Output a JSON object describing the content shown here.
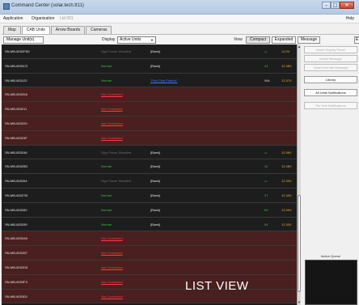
{
  "window": {
    "title": "Command Center (solar.tech.tt11)",
    "controls": {
      "minimize": "–",
      "maximize": "□",
      "close": "✕"
    }
  },
  "menubar": {
    "items": [
      "Application",
      "Organization",
      "Ltd 001"
    ],
    "help": "Help"
  },
  "tabs": [
    {
      "label": "Map",
      "active": false
    },
    {
      "label": "CAB Units",
      "active": true
    },
    {
      "label": "Arrow Boards",
      "active": false
    },
    {
      "label": "Cameras",
      "active": false
    }
  ],
  "toolbar": {
    "manage_label": "Manage Unit(s)",
    "display_label": "Display",
    "display_value": "Active Units",
    "view_label": "View",
    "view_options": [
      "Compact",
      "Expanded",
      "Message"
    ],
    "view_selected": "Compact",
    "edge_label": "E"
  },
  "units": [
    {
      "id": "SN-MB-8032F6D",
      "status": "Sign Power Disabled",
      "msg": "[Blank]",
      "v": "ٹ",
      "bat": "12.0V",
      "state": "ok"
    },
    {
      "id": "SN-MB-8030C2",
      "status": "Normal",
      "msg": "[Blank]",
      "v": "41",
      "bat": "12.38V",
      "state": "ok"
    },
    {
      "id": "SN-MB-803122",
      "status": "Normal",
      "msg": "\"Print Test Pattern\"",
      "v": "N/A",
      "bat": "12.57V",
      "state": "ok"
    },
    {
      "id": "SN-MB-80320A",
      "status": "Not Connected",
      "msg": "",
      "v": "",
      "bat": "",
      "state": "nc"
    },
    {
      "id": "SN-MB-803211",
      "status": "Not Connected",
      "msg": "",
      "v": "",
      "bat": "",
      "state": "nc"
    },
    {
      "id": "SN-MB-803229",
      "status": "Not Connected",
      "msg": "",
      "v": "",
      "bat": "",
      "state": "nc"
    },
    {
      "id": "SN-MB-80323F",
      "status": "Not Connected",
      "msg": "",
      "v": "",
      "bat": "",
      "state": "nc"
    },
    {
      "id": "SN-MB-803246",
      "status": "Sign Power Disabled",
      "msg": "[Blank]",
      "v": "ٹ",
      "bat": "12.58V",
      "state": "ok"
    },
    {
      "id": "SN-MB-80325D",
      "status": "Normal",
      "msg": "[Blank]",
      "v": "42",
      "bat": "12.48V",
      "state": "ok"
    },
    {
      "id": "SN-MB-803264",
      "status": "Sign Power Disabled",
      "msg": "[Blank]",
      "v": "ٹ",
      "bat": "12.39V",
      "state": "ok"
    },
    {
      "id": "SN-MB-80327B",
      "status": "Normal",
      "msg": "[Blank]",
      "v": "37",
      "bat": "12.49V",
      "state": "ok"
    },
    {
      "id": "SN-MB-803282",
      "status": "Normal",
      "msg": "[Blank]",
      "v": "69",
      "bat": "12.59V",
      "state": "ok"
    },
    {
      "id": "SN-MB-803299",
      "status": "Normal",
      "msg": "[Blank]",
      "v": "54",
      "bat": "12.53V",
      "state": "ok"
    },
    {
      "id": "SN-MB-8032A0",
      "status": "Not Connected",
      "msg": "",
      "v": "",
      "bat": "",
      "state": "nc"
    },
    {
      "id": "SN-MB-8032B7",
      "status": "Not Connected",
      "msg": "",
      "v": "",
      "bat": "",
      "state": "nc"
    },
    {
      "id": "SN-MB-8032D5",
      "status": "Not Connected",
      "msg": "",
      "v": "",
      "bat": "",
      "state": "nc"
    },
    {
      "id": "SN-MB-8033F3",
      "status": "Not Connected",
      "msg": "",
      "v": "",
      "bat": "",
      "state": "nc"
    },
    {
      "id": "SN-MB-803303",
      "status": "Not Connected",
      "msg": "",
      "v": "",
      "bat": "",
      "state": "nc"
    }
  ],
  "right_panel": {
    "buttons": [
      {
        "label": "Blank Display Panel",
        "enabled": false
      },
      {
        "label": "Install Message",
        "enabled": false
      },
      {
        "label": "Clear/Override Message",
        "enabled": false
      },
      {
        "label": "Library",
        "enabled": true
      },
      {
        "label": "All Units Notifications",
        "enabled": true
      },
      {
        "label": "Per Unit Notifications",
        "enabled": false
      }
    ],
    "action_queue_label": "Action Queue"
  },
  "scroll": {
    "up": "▲",
    "down": "▼"
  },
  "overlay_text": "LIST VIEW",
  "colors": {
    "row_ok_bg": "#1d1d1d",
    "row_nc_bg": "#4a1f1f",
    "status_normal": "#36c236",
    "status_disabled": "#6f6f6f",
    "status_not_connected": "#ff3b3b",
    "link_message": "#3c7cff",
    "battery": "#e0b03a"
  }
}
